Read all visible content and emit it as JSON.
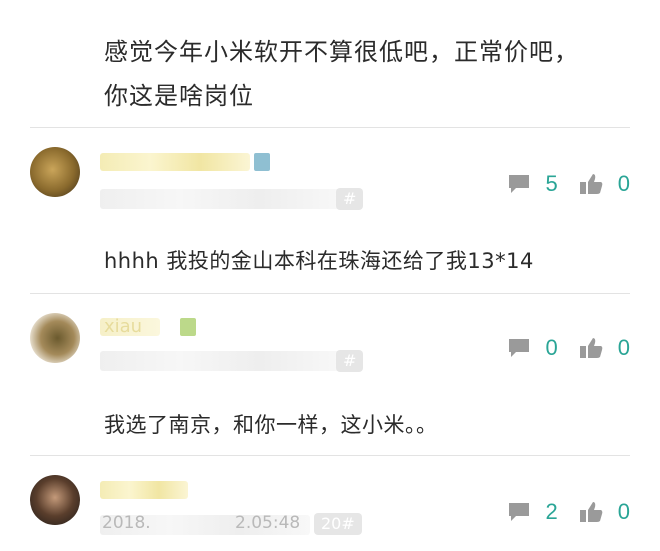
{
  "top_comment": {
    "line1": "感觉今年小米软开不算很低吧，正常价吧，",
    "line2": "你这是啥岗位"
  },
  "comments": [
    {
      "floor_badge": "#",
      "comment_count": "5",
      "like_count": "0",
      "text": "hhhh 我投的金山本科在珠海还给了我13*14"
    },
    {
      "name_fragment": "xiau",
      "floor_badge": "#",
      "comment_count": "0",
      "like_count": "0",
      "text": "我选了南京，和你一样，这小米。。"
    },
    {
      "date_left": "2018.",
      "time_right": "2.05:48",
      "floor_badge": "20#",
      "comment_count": "2",
      "like_count": "0"
    }
  ],
  "icons": {
    "comment": "speech-bubble-icon",
    "like": "thumbs-up-icon"
  },
  "colors": {
    "accent": "#2aa596",
    "icon": "#9a9a9a",
    "divider": "#e3e3e3"
  }
}
